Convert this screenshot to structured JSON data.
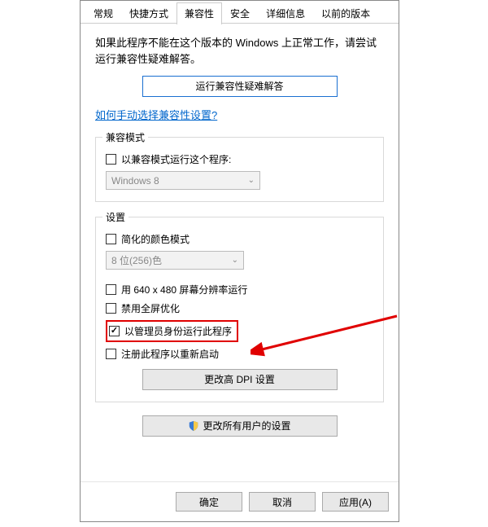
{
  "tabs": {
    "general": "常规",
    "shortcut": "快捷方式",
    "compat": "兼容性",
    "security": "安全",
    "details": "详细信息",
    "previous": "以前的版本"
  },
  "intro": "如果此程序不能在这个版本的 Windows 上正常工作，请尝试运行兼容性疑难解答。",
  "troubleshoot_btn": "运行兼容性疑难解答",
  "manual_link": "如何手动选择兼容性设置?",
  "compat_mode": {
    "title": "兼容模式",
    "checkbox": "以兼容模式运行这个程序:",
    "value": "Windows 8"
  },
  "settings": {
    "title": "设置",
    "reduced_color": "简化的颜色模式",
    "color_value": "8 位(256)色",
    "res_640": "用 640 x 480 屏幕分辨率运行",
    "disable_fullscreen_opt": "禁用全屏优化",
    "run_as_admin": "以管理员身份运行此程序",
    "restart_register": "注册此程序以重新启动",
    "dpi_btn": "更改高 DPI 设置"
  },
  "all_users_btn": "更改所有用户的设置",
  "footer": {
    "ok": "确定",
    "cancel": "取消",
    "apply": "应用(A)"
  }
}
